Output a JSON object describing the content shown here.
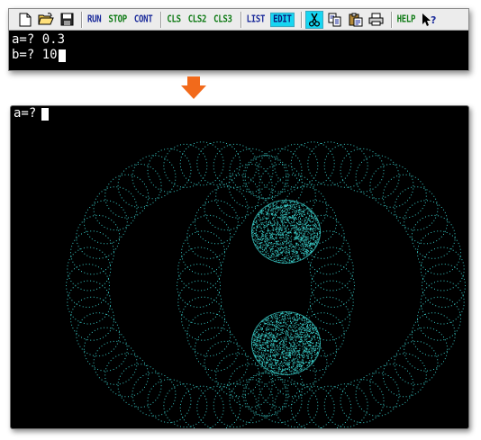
{
  "toolbar": {
    "icons": [
      "new-file-icon",
      "open-folder-icon",
      "save-disk-icon"
    ],
    "run_label": "RUN",
    "stop_label": "STOP",
    "cont_label": "CONT",
    "cls_label": "CLS",
    "cls2_label": "CLS2",
    "cls3_label": "CLS3",
    "list_label": "LIST",
    "edit_label": "EDIT",
    "edit_icons": [
      "scissors-icon",
      "copy-icon",
      "paste-icon",
      "print-icon"
    ],
    "help_label": "HELP",
    "help_icon": "context-help-icon"
  },
  "console": {
    "line1": "a=? 0.3",
    "line2": "b=? 10"
  },
  "output": {
    "prompt": "a=?",
    "dot_color": "#37c4c0"
  },
  "colors": {
    "arrow": "#f26a1b",
    "active_button": "#16d6f2"
  }
}
